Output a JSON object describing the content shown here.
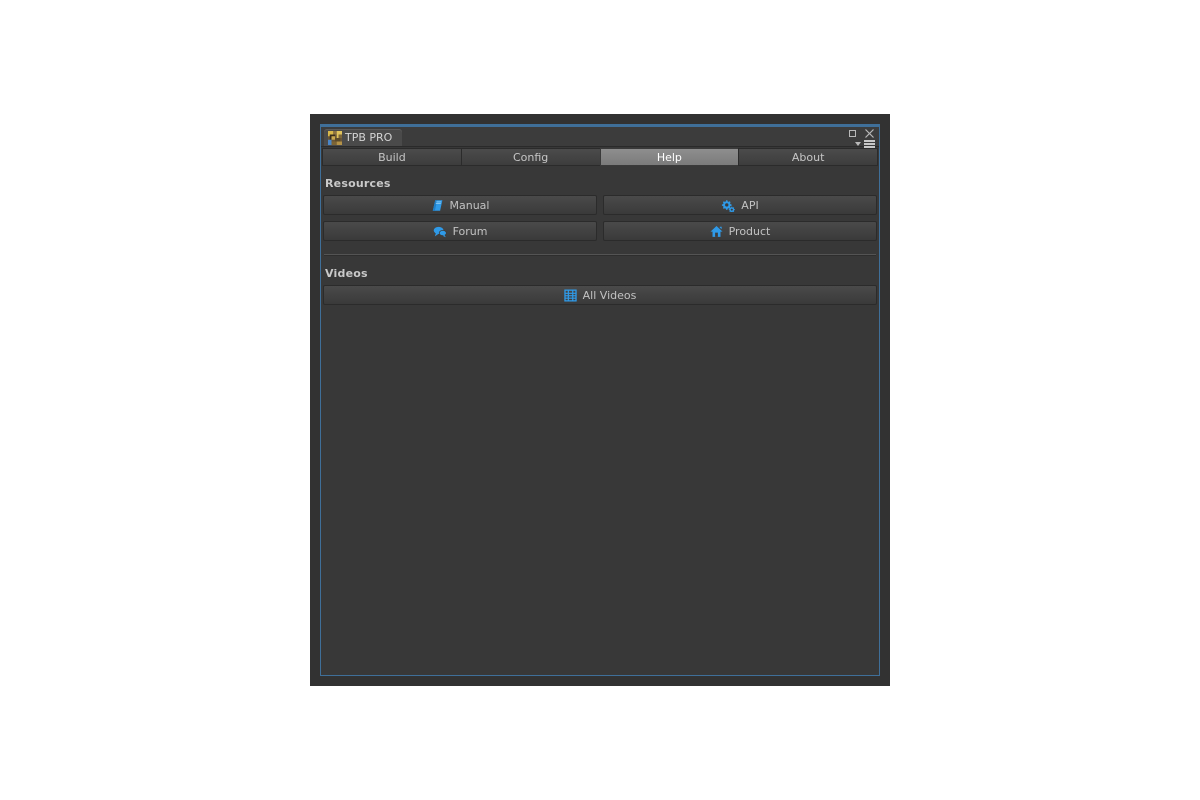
{
  "window": {
    "tab_title": "TPB PRO",
    "controls": {
      "maximize_label": "maximize",
      "close_label": "×",
      "menu_label": "menu"
    }
  },
  "tabs": [
    {
      "label": "Build",
      "active": false
    },
    {
      "label": "Config",
      "active": false
    },
    {
      "label": "Help",
      "active": true
    },
    {
      "label": "About",
      "active": false
    }
  ],
  "sections": {
    "resources": {
      "title": "Resources",
      "buttons": [
        {
          "label": "Manual",
          "icon": "book-icon"
        },
        {
          "label": "API",
          "icon": "gears-icon"
        },
        {
          "label": "Forum",
          "icon": "speech-bubbles-icon"
        },
        {
          "label": "Product",
          "icon": "home-icon"
        }
      ]
    },
    "videos": {
      "title": "Videos",
      "buttons": [
        {
          "label": "All Videos",
          "icon": "film-strip-icon"
        }
      ]
    }
  },
  "colors": {
    "accent_blue": "#3f6f99",
    "icon_blue": "#2f9ae8",
    "panel_bg": "#383838",
    "window_bg": "#323232",
    "text": "#c2c2c2",
    "active_tab_bg": "#8e8e8e"
  }
}
